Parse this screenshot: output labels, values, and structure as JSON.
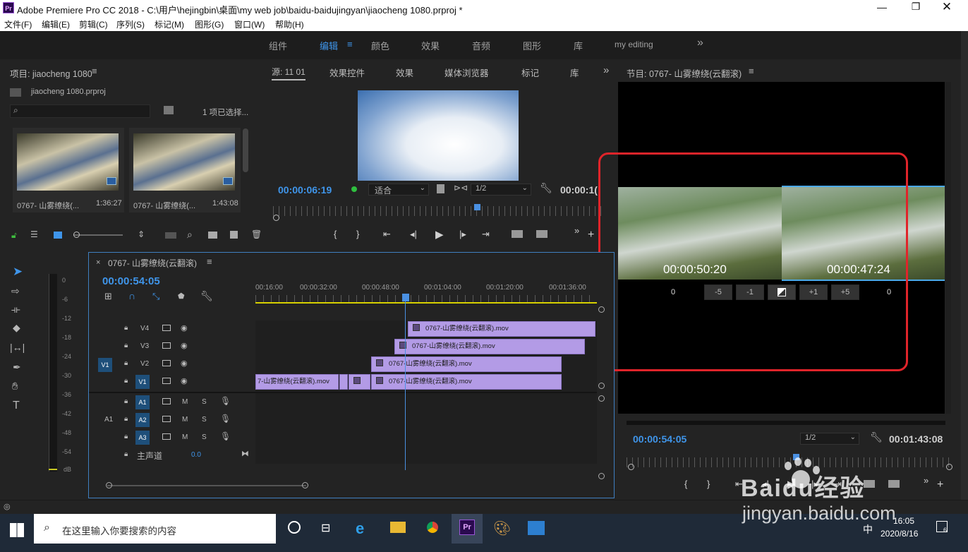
{
  "window": {
    "title": "Adobe Premiere Pro CC 2018 - C:\\用户\\hejingbin\\桌面\\my web job\\baidu-baidujingyan\\jiaocheng 1080.prproj *",
    "app_icon": "Pr"
  },
  "menu": [
    "文件(F)",
    "编辑(E)",
    "剪辑(C)",
    "序列(S)",
    "标记(M)",
    "图形(G)",
    "窗口(W)",
    "帮助(H)"
  ],
  "workspaces": [
    "组件",
    "编辑",
    "颜色",
    "效果",
    "音频",
    "图形",
    "库",
    "my editing"
  ],
  "project": {
    "tab": "项目: jiaocheng 1080",
    "file": "jiaocheng 1080.prproj",
    "selection": "1 项已选择...",
    "items": [
      {
        "name": "0767- 山雾缭绕(...",
        "duration": "1:36:27"
      },
      {
        "name": "0767- 山雾缭绕(...",
        "duration": "1:43:08"
      }
    ]
  },
  "source": {
    "tabs": [
      "源: 11 01",
      "效果控件",
      "效果",
      "媒体浏览器",
      "标记",
      "库"
    ],
    "timecode": "00:00:06:19",
    "fit": "适合",
    "resolution": "1/2",
    "end_timecode": "00:00:1("
  },
  "program": {
    "tab": "节目: 0767- 山雾缭绕(云翻滚)",
    "left_tc": "00:00:50:20",
    "right_tc": "00:00:47:24",
    "left_offset": "0",
    "right_offset": "0",
    "trim_buttons": [
      "-5",
      "-1",
      "+1",
      "+5"
    ],
    "timecode": "00:00:54:05",
    "resolution": "1/2",
    "duration": "00:01:43:08"
  },
  "timeline": {
    "tab": "0767- 山雾缭绕(云翻滚)",
    "timecode": "00:00:54:05",
    "ruler": [
      "00:16:00",
      "00:00:32:00",
      "00:00:48:00",
      "00:01:04:00",
      "00:01:20:00",
      "00:01:36:00"
    ],
    "video_tracks": [
      "V4",
      "V3",
      "V2",
      "V1"
    ],
    "audio_tracks": [
      "A1",
      "A2",
      "A3"
    ],
    "source_v": "V1",
    "source_a": "A1",
    "master_label": "主声道",
    "master_value": "0.0",
    "clips": {
      "v4": "0767-山雾缭绕(云翻滚).mov",
      "v3": "0767-山雾缭绕(云翻滚).mov",
      "v2": "0767-山雾缭绕(云翻滚).mov",
      "v1a": "7-山雾缭绕(云翻滚).mov",
      "v1b": "0767-山雾缭绕(云翻滚).mov"
    },
    "audio_labels": {
      "m": "M",
      "s": "S"
    }
  },
  "meter": [
    "0",
    "-6",
    "-12",
    "-18",
    "-24",
    "-30",
    "-36",
    "-42",
    "-48",
    "-54",
    "dB"
  ],
  "taskbar": {
    "search_placeholder": "在这里输入你要搜索的内容",
    "time": "16:05",
    "date": "2020/8/16",
    "ime": "中",
    "notifications": "6"
  },
  "watermark": {
    "brand": "Baidu经验",
    "url": "jingyan.baidu.com"
  },
  "colors": {
    "accent": "#3f95ea",
    "clip": "#b39be6",
    "highlight": "#e0242a",
    "playhead": "#4a90e2"
  }
}
